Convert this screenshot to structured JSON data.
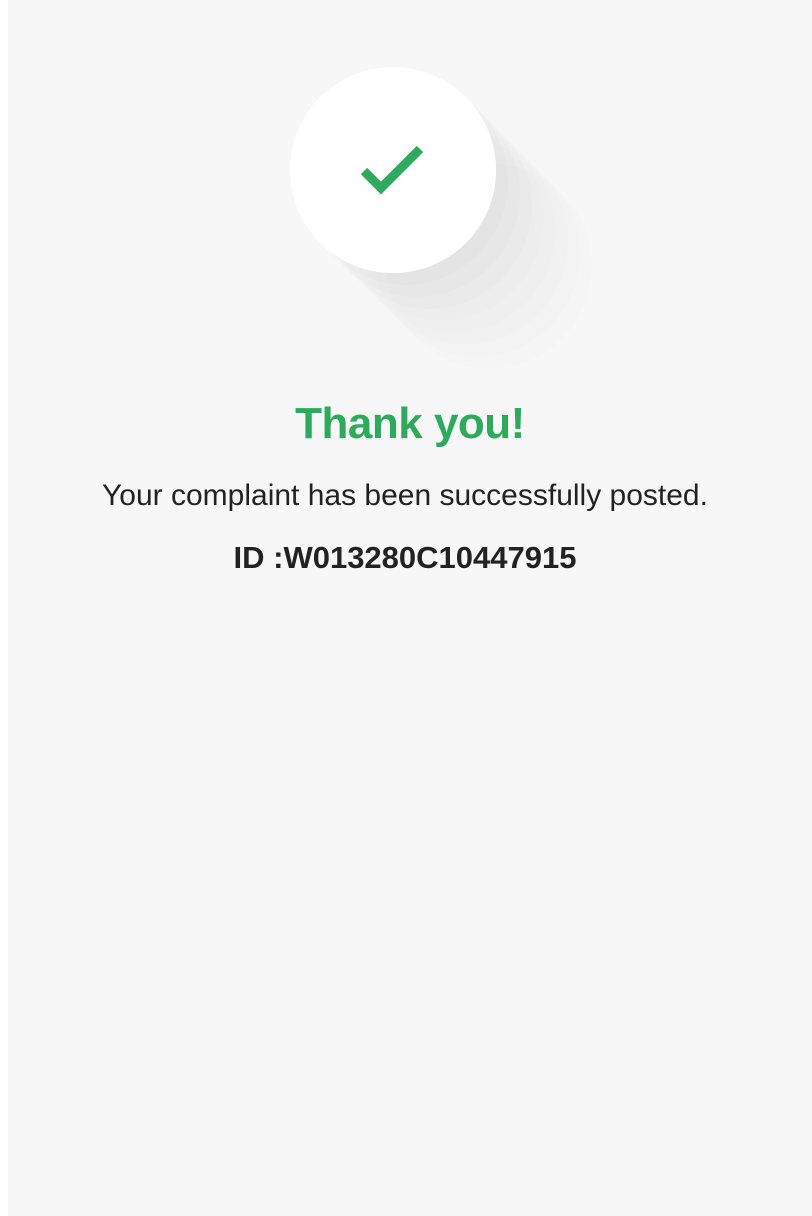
{
  "success": {
    "icon": "check-icon",
    "accent_color": "#2daa5c",
    "title": "Thank you!",
    "message": "Your complaint has been successfully posted.",
    "complaint_id": "ID :W013280C10447915"
  }
}
